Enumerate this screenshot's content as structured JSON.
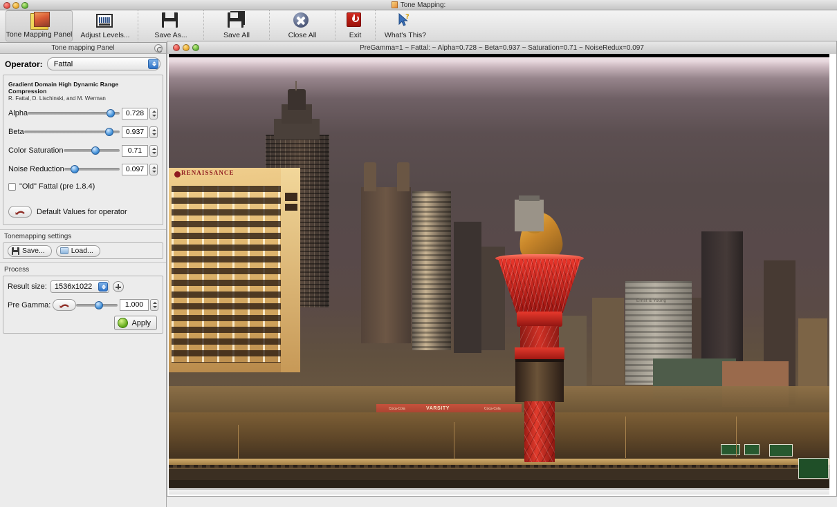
{
  "window": {
    "title": "Tone Mapping:",
    "traffic_lights": [
      "close-red",
      "minimize-yellow",
      "zoom-green"
    ]
  },
  "toolbar": {
    "items": [
      {
        "label": "Tone Mapping Panel",
        "icon": "tone-mapping-panel-icon",
        "active": true
      },
      {
        "label": "Adjust Levels...",
        "icon": "histogram-icon",
        "active": false
      },
      {
        "label": "Save As...",
        "icon": "floppy-disk-icon",
        "active": false
      },
      {
        "label": "Save All",
        "icon": "floppy-disk-multiple-icon",
        "active": false
      },
      {
        "label": "Close All",
        "icon": "close-circle-icon",
        "active": false
      },
      {
        "label": "Exit",
        "icon": "power-icon",
        "active": false
      },
      {
        "label": "What's This?",
        "icon": "cursor-question-icon",
        "active": false
      }
    ]
  },
  "panel": {
    "header": "Tone mapping Panel",
    "operator_label": "Operator:",
    "operator_value": "Fattal",
    "operator_options": [
      "Fattal"
    ],
    "credit_title": "Gradient Domain High Dynamic Range Compression",
    "credit_authors": "R. Fattal, D. Lischinski, and M. Werman",
    "sliders": [
      {
        "label": "Alpha",
        "value": "0.728",
        "percent": 86
      },
      {
        "label": "Beta",
        "value": "0.937",
        "percent": 85
      },
      {
        "label": "Color Saturation",
        "value": "0.71",
        "percent": 50
      },
      {
        "label": "Noise Reduction",
        "value": "0.097",
        "percent": 12
      }
    ],
    "checkbox": {
      "label": "\"Old\" Fattal (pre 1.8.4)",
      "checked": false
    },
    "defaults_label": "Default Values for operator",
    "settings_section": "Tonemapping settings",
    "save_label": "Save...",
    "load_label": "Load...",
    "process_section": "Process",
    "result_size_label": "Result size:",
    "result_size_value": "1536x1022",
    "pre_gamma_label": "Pre Gamma:",
    "pre_gamma_value": "1.000",
    "pre_gamma_percent": 45,
    "apply_label": "Apply"
  },
  "image_window": {
    "title": "PreGamma=1 ~ Fattal: ~ Alpha=0.728 ~ Beta=0.937 ~ Saturation=0.71 ~ NoiseRedux=0.097",
    "traffic_lights": [
      "close-red",
      "minimize-yellow",
      "zoom-green"
    ],
    "photo_alt": "Atlanta skyline at sunset with Olympic torch",
    "photo_signs": {
      "hotel": "RENAISSANCE",
      "accounting": "Ernst & Young",
      "diner": "VARSITY",
      "soda": "Coca-Cola"
    }
  },
  "colors": {
    "accent_blue": "#2f74c8",
    "torch_red": "#d83227",
    "flame_gold": "#c8862a",
    "panel_bg": "#ececec"
  }
}
